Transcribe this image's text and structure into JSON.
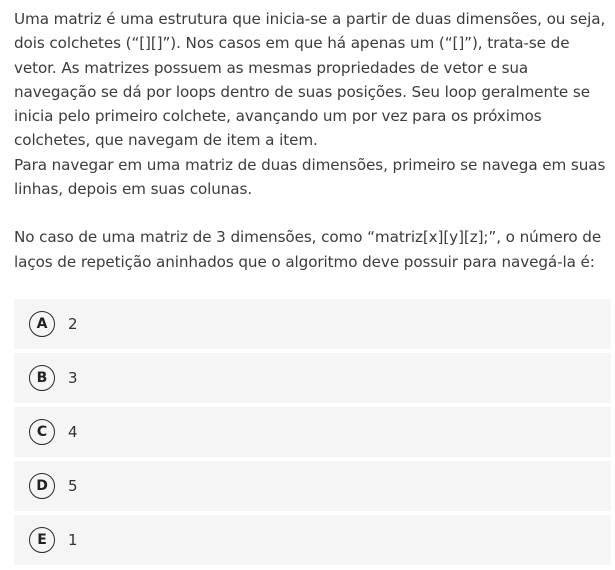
{
  "question": {
    "paragraph_1": "Uma matriz é uma estrutura que inicia-se a partir de duas dimensões, ou seja, dois colchetes (“[][]”). Nos casos em que há apenas um (“[]”), trata-se de vetor. As matrizes possuem as mesmas propriedades de vetor e sua navegação se dá por loops dentro de suas posições. Seu loop geralmente se inicia pelo primeiro colchete, avançando um por vez para os próximos colchetes, que navegam de item a item.",
    "paragraph_2": "Para navegar em uma matriz de duas dimensões, primeiro se navega em suas linhas, depois em suas colunas.",
    "paragraph_3": "No caso de uma matriz de 3 dimensões, como “matriz[x][y][z];”, o número de laços de repetição aninhados que o algoritmo deve possuir para navegá-la é:"
  },
  "options": [
    {
      "letter": "A",
      "text": "2"
    },
    {
      "letter": "B",
      "text": "3"
    },
    {
      "letter": "C",
      "text": "4"
    },
    {
      "letter": "D",
      "text": "5"
    },
    {
      "letter": "E",
      "text": "1"
    }
  ]
}
